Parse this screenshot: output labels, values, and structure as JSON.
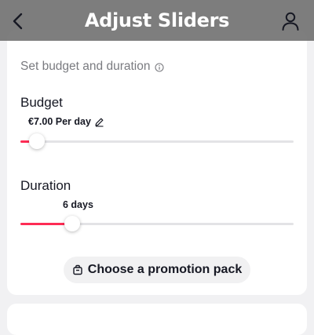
{
  "header": {
    "title": "Adjust Sliders",
    "back_icon": "chevron-left-icon",
    "profile_icon": "user-icon"
  },
  "section": {
    "title": "Set budget and duration",
    "info_icon": "info-icon"
  },
  "budget": {
    "label": "Budget",
    "value": "€7.00 Per day",
    "edit_icon": "pencil-icon",
    "slider_fraction": 0.06
  },
  "duration": {
    "label": "Duration",
    "value": "6 days",
    "slider_fraction": 0.19
  },
  "promotion": {
    "button_label": "Choose a promotion pack",
    "icon": "package-icon"
  },
  "colors": {
    "accent": "#fe2c55",
    "track": "#e3e3e6",
    "header_overlay": "#6c6c6c"
  }
}
